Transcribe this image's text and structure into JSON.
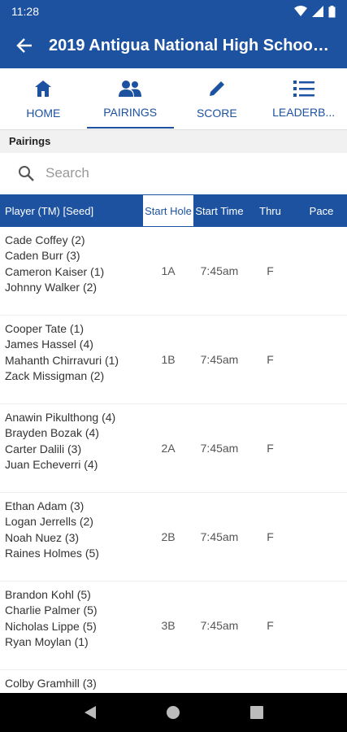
{
  "status_bar": {
    "time": "11:28"
  },
  "app_bar": {
    "title": "2019 Antigua National High School..."
  },
  "tabs": [
    {
      "label": "HOME",
      "icon": "home-icon",
      "active": false
    },
    {
      "label": "PAIRINGS",
      "icon": "people-icon",
      "active": true
    },
    {
      "label": "SCORE",
      "icon": "pencil-icon",
      "active": false
    },
    {
      "label": "LEADERB...",
      "icon": "list-icon",
      "active": false
    }
  ],
  "section": {
    "title": "Pairings"
  },
  "search": {
    "placeholder": "Search",
    "value": ""
  },
  "table": {
    "headers": {
      "player": "Player (TM) [Seed]",
      "start_hole": "Start Hole",
      "start_time": "Start Time",
      "thru": "Thru",
      "pace": "Pace"
    },
    "rows": [
      {
        "players": [
          "Cade Coffey (2)",
          "Caden Burr (3)",
          "Cameron Kaiser (1)",
          "Johnny Walker (2)"
        ],
        "start_hole": "1A",
        "start_time": "7:45am",
        "thru": "F",
        "pace": ""
      },
      {
        "players": [
          "Cooper Tate (1)",
          "James Hassel (4)",
          "Mahanth Chirravuri (1)",
          "Zack Missigman (2)"
        ],
        "start_hole": "1B",
        "start_time": "7:45am",
        "thru": "F",
        "pace": ""
      },
      {
        "players": [
          "Anawin Pikulthong (4)",
          "Brayden Bozak (4)",
          "Carter Dalili (3)",
          "Juan Echeverri (4)"
        ],
        "start_hole": "2A",
        "start_time": "7:45am",
        "thru": "F",
        "pace": ""
      },
      {
        "players": [
          "Ethan Adam (3)",
          "Logan Jerrells (2)",
          "Noah Nuez (3)",
          "Raines Holmes (5)"
        ],
        "start_hole": "2B",
        "start_time": "7:45am",
        "thru": "F",
        "pace": ""
      },
      {
        "players": [
          "Brandon Kohl (5)",
          "Charlie Palmer (5)",
          "Nicholas Lippe (5)",
          "Ryan Moylan (1)"
        ],
        "start_hole": "3B",
        "start_time": "7:45am",
        "thru": "F",
        "pace": ""
      },
      {
        "players": [
          "Colby Gramhill (3)"
        ],
        "start_hole": "",
        "start_time": "",
        "thru": "",
        "pace": ""
      }
    ]
  },
  "colors": {
    "primary": "#1d52a0",
    "header_bg": "#f1f1f1",
    "nav_bg": "#000000"
  }
}
